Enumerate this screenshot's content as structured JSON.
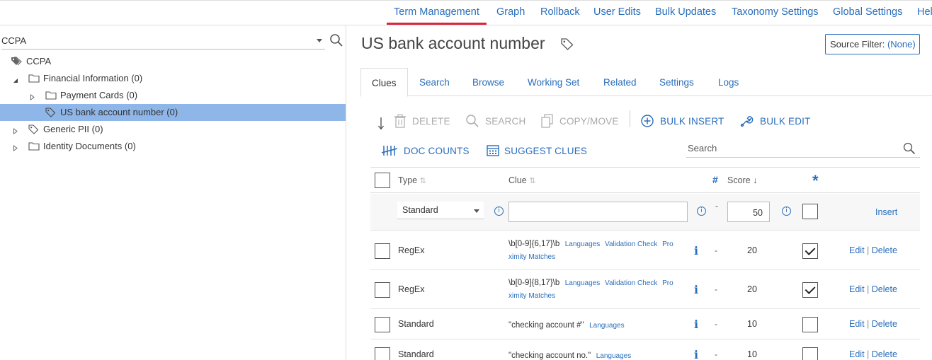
{
  "nav": {
    "items": [
      {
        "label": "Term Management",
        "active": true
      },
      {
        "label": "Graph"
      },
      {
        "label": "Rollback"
      },
      {
        "label": "User Edits"
      },
      {
        "label": "Bulk Updates"
      },
      {
        "label": "Taxonomy Settings"
      },
      {
        "label": "Global Settings"
      },
      {
        "label": "Hel"
      }
    ]
  },
  "sidebar": {
    "dropdown_value": "CCPA",
    "tree": [
      {
        "label": "CCPA",
        "icon": "tags-icon",
        "expander": "none"
      },
      {
        "label": "Financial Information (0)",
        "icon": "folder-icon",
        "expander": "expanded"
      },
      {
        "label": "Payment Cards (0)",
        "icon": "folder-icon",
        "expander": "collapsed"
      },
      {
        "label": "US bank account number (0)",
        "icon": "tag-icon",
        "expander": "none",
        "selected": true
      },
      {
        "label": "Generic PII (0)",
        "icon": "tag-icon",
        "expander": "collapsed"
      },
      {
        "label": "Identity Documents (0)",
        "icon": "folder-icon",
        "expander": "collapsed"
      }
    ]
  },
  "main": {
    "title": "US bank account number",
    "source_filter_label": "Source Filter:",
    "source_filter_value": "(None)",
    "tabs": [
      "Clues",
      "Search",
      "Browse",
      "Working Set",
      "Related",
      "Settings",
      "Logs"
    ],
    "active_tab": "Clues",
    "toolbar": {
      "delete": "DELETE",
      "search": "SEARCH",
      "copy_move": "COPY/MOVE",
      "bulk_insert": "BULK INSERT",
      "bulk_edit": "BULK EDIT",
      "doc_counts": "DOC COUNTS",
      "suggest_clues": "SUGGEST CLUES"
    },
    "search_placeholder": "Search",
    "grid": {
      "headers": {
        "type": "Type",
        "clue": "Clue",
        "hash": "#",
        "score": "Score",
        "star": "*"
      },
      "insert_row": {
        "type_value": "Standard",
        "clue_value": "",
        "dash": "-",
        "score_value": "50",
        "insert_label": "Insert"
      },
      "rows": [
        {
          "type": "RegEx",
          "clue": "\\b[0-9]{6,17}\\b",
          "links_line1": [
            "Languages",
            "Validation Check",
            "Pro"
          ],
          "links_line2": "ximity Matches",
          "dash": "-",
          "score": "20",
          "checked": true
        },
        {
          "type": "RegEx",
          "clue": "\\b[0-9]{8,17}\\b",
          "links_line1": [
            "Languages",
            "Validation Check",
            "Pro"
          ],
          "links_line2": "ximity Matches",
          "dash": "-",
          "score": "20",
          "checked": true
        },
        {
          "type": "Standard",
          "clue": "\"checking account #\"",
          "links_line1": [
            "Languages"
          ],
          "links_line2": "",
          "dash": "-",
          "score": "10",
          "checked": false
        },
        {
          "type": "Standard",
          "clue": "\"checking account no.\"",
          "links_line1": [
            "Languages"
          ],
          "links_line2": "",
          "dash": "-",
          "score": "10",
          "checked": false
        }
      ],
      "edit_label": "Edit",
      "sep": "|",
      "delete_label": "Delete"
    }
  }
}
